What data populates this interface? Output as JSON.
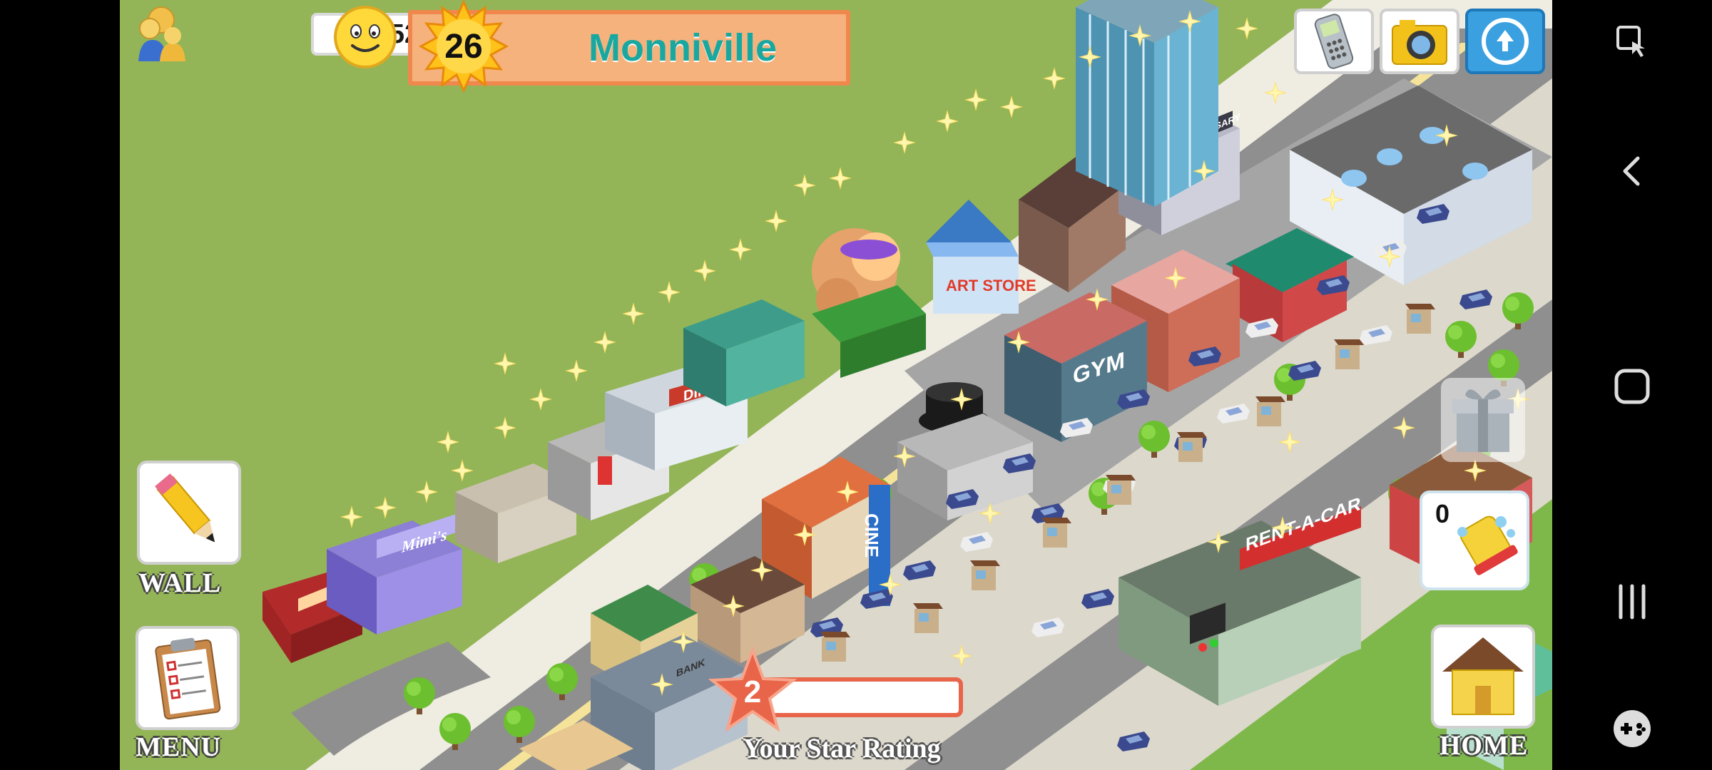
{
  "hud": {
    "coins": "30,952",
    "level": "26",
    "city_name": "Monniville",
    "star_rating_value": "2",
    "star_rating_label": "Your Star Rating",
    "cleaner_count": "0"
  },
  "buttons": {
    "wall_label": "WALL",
    "menu_label": "MENU",
    "home_label": "HOME"
  },
  "buildings": {
    "diner_sign": "DINER",
    "mimis_sign": "Mimi's",
    "gym_sign": "GYM",
    "rentacar_sign": "RENT-A-CAR",
    "commissary_sign": "COMMISSARY",
    "art_store_sign": "ART STORE",
    "cinema_sign": "CINE",
    "bank_sign": "BANK"
  },
  "colors": {
    "grass": "#93b557",
    "city_name": "#19a8a0",
    "city_bar": "#f6b27d",
    "star": "#e8654a"
  },
  "icons": {
    "coins": "people-coins-icon",
    "mood": "smiley-face-icon",
    "phone": "phone-icon",
    "camera": "camera-icon",
    "share": "share-icon",
    "gift": "gift-icon",
    "cleaner": "cleaner-icon"
  }
}
